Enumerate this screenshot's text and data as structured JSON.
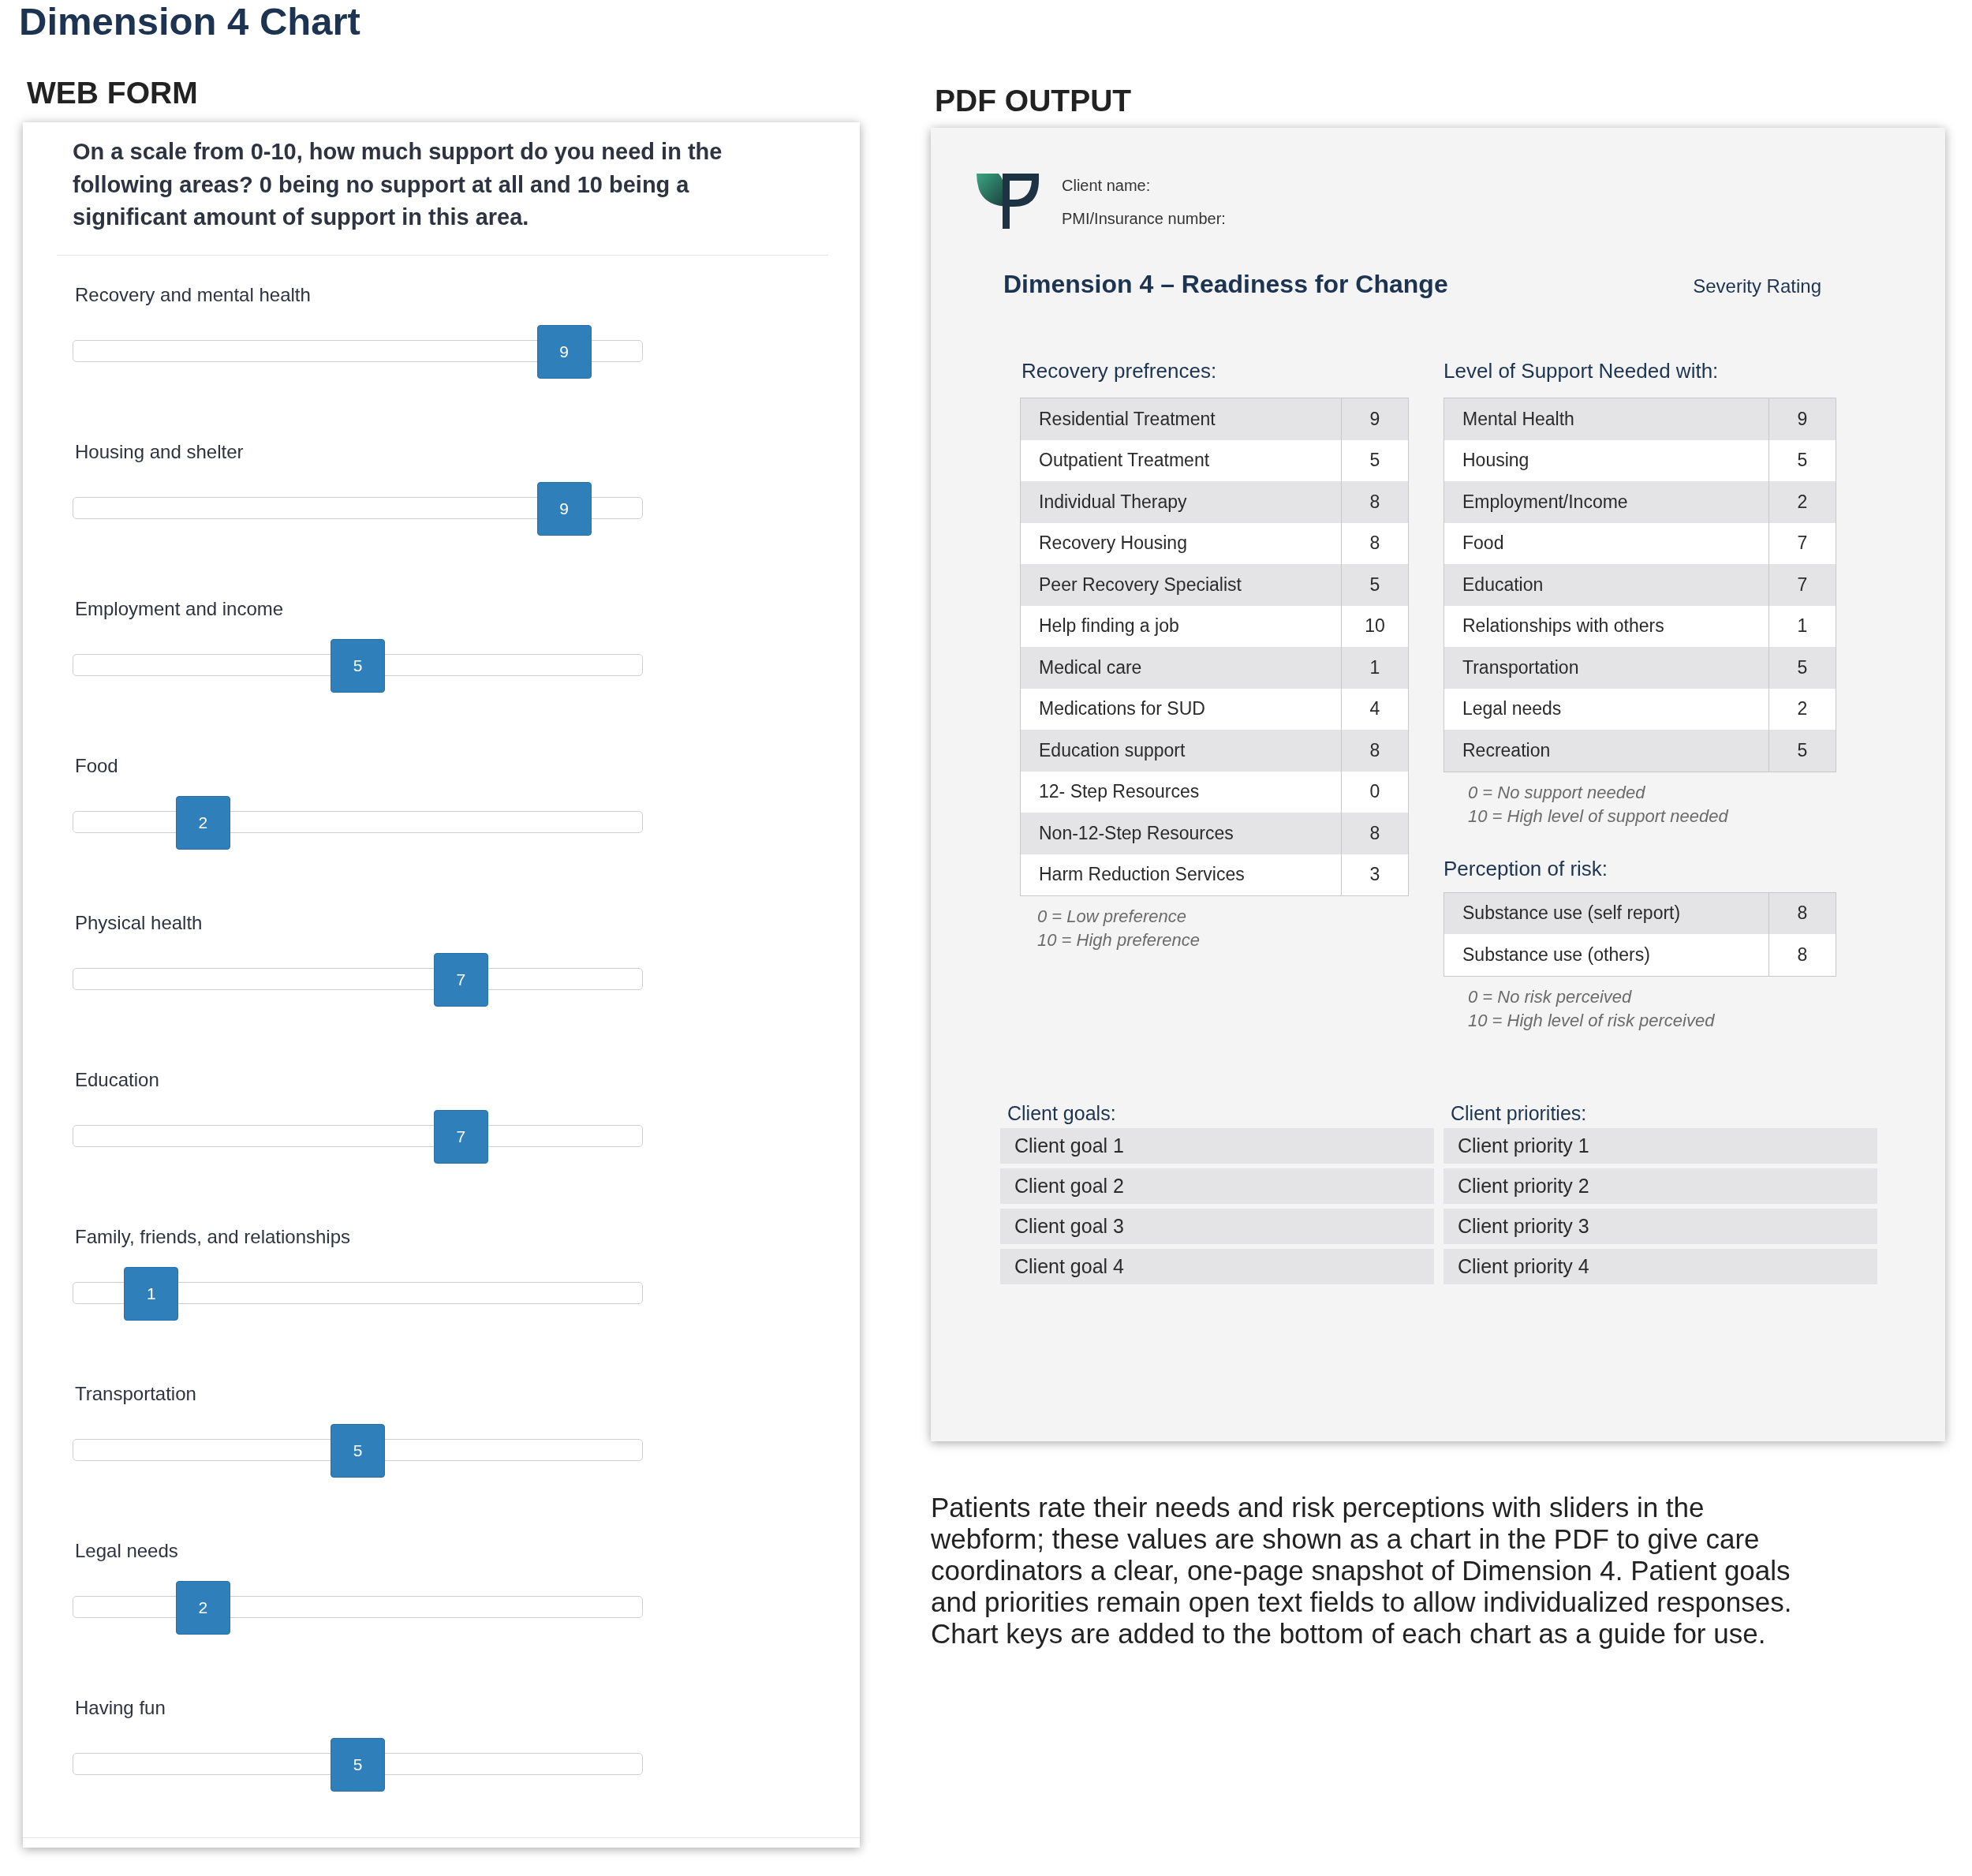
{
  "page_title": "Dimension 4 Chart",
  "web_form": {
    "heading": "WEB FORM",
    "question": "On a scale from 0-10, how much support do you need in the following areas? 0 being no support at all and 10 being a significant amount of support in this area.",
    "sliders": [
      {
        "label": "Recovery and mental health",
        "value": "9",
        "level": 0.9
      },
      {
        "label": "Housing and shelter",
        "value": "9",
        "level": 0.9
      },
      {
        "label": "Employment and income",
        "value": "5",
        "level": 0.5
      },
      {
        "label": "Food",
        "value": "2",
        "level": 0.2
      },
      {
        "label": "Physical health",
        "value": "7",
        "level": 0.7
      },
      {
        "label": "Education",
        "value": "7",
        "level": 0.7
      },
      {
        "label": "Family, friends, and relationships",
        "value": "1",
        "level": 0.1
      },
      {
        "label": "Transportation",
        "value": "5",
        "level": 0.5
      },
      {
        "label": "Legal needs",
        "value": "2",
        "level": 0.2
      },
      {
        "label": "Having fun",
        "value": "5",
        "level": 0.5
      }
    ]
  },
  "pdf_output": {
    "heading": "PDF OUTPUT",
    "client_fields": [
      "Client name:",
      "PMI/Insurance number:"
    ],
    "title": "Dimension 4 – Readiness for Change",
    "severity_label": "Severity Rating",
    "recovery_preferences": {
      "title": "Recovery prefrences:",
      "rows": [
        {
          "label": "Residential Treatment",
          "value": "9"
        },
        {
          "label": "Outpatient Treatment",
          "value": "5"
        },
        {
          "label": "Individual Therapy",
          "value": "8"
        },
        {
          "label": "Recovery Housing",
          "value": "8"
        },
        {
          "label": "Peer Recovery Specialist",
          "value": "5"
        },
        {
          "label": "Help finding a job",
          "value": "10"
        },
        {
          "label": "Medical care",
          "value": "1"
        },
        {
          "label": "Medications for SUD",
          "value": "4"
        },
        {
          "label": "Education support",
          "value": "8"
        },
        {
          "label": "12- Step Resources",
          "value": "0"
        },
        {
          "label": "Non-12-Step Resources",
          "value": "8"
        },
        {
          "label": "Harm Reduction Services",
          "value": "3"
        }
      ],
      "key": [
        "0 = Low preference",
        "10 = High preference"
      ]
    },
    "support_needed": {
      "title": "Level of Support Needed with:",
      "rows": [
        {
          "label": "Mental Health",
          "value": "9"
        },
        {
          "label": "Housing",
          "value": "5"
        },
        {
          "label": "Employment/Income",
          "value": "2"
        },
        {
          "label": "Food",
          "value": "7"
        },
        {
          "label": "Education",
          "value": "7"
        },
        {
          "label": "Relationships with others",
          "value": "1"
        },
        {
          "label": "Transportation",
          "value": "5"
        },
        {
          "label": "Legal needs",
          "value": "2"
        },
        {
          "label": "Recreation",
          "value": "5"
        }
      ],
      "key": [
        "0 = No support needed",
        "10 = High level of support needed"
      ]
    },
    "risk_perception": {
      "title": "Perception of risk:",
      "rows": [
        {
          "label": "Substance use (self report)",
          "value": "8"
        },
        {
          "label": "Substance use (others)",
          "value": "8"
        }
      ],
      "key": [
        "0 = No risk perceived",
        "10 = High level of risk perceived"
      ]
    },
    "client_goals": {
      "title": "Client goals:",
      "items": [
        "Client goal 1",
        "Client goal 2",
        "Client goal 3",
        "Client goal 4"
      ]
    },
    "client_priorities": {
      "title": "Client priorities:",
      "items": [
        "Client priority 1",
        "Client priority 2",
        "Client priority 3",
        "Client priority 4"
      ]
    }
  },
  "description": "Patients rate their needs and risk perceptions with sliders in the webform; these values are shown as a chart in the PDF to give care coordinators a clear, one-page snapshot of Dimension 4. Patient goals and priorities remain open text fields to allow individualized responses. Chart keys are added to the bottom of each chart as a guide for use."
}
